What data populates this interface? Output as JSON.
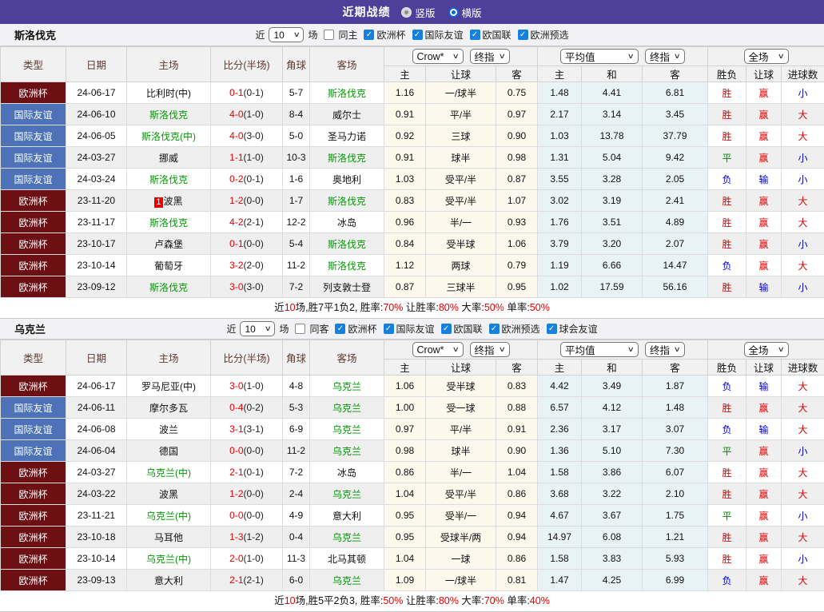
{
  "header": {
    "title": "近期战绩",
    "radios": [
      {
        "label": "竖版",
        "selected": false
      },
      {
        "label": "横版",
        "selected": true
      }
    ]
  },
  "colors": {
    "topbar_purple": "#4e3f9a",
    "type_euro_maroon": "#6d1014",
    "type_friendly_blue": "#4e72b8",
    "team_green": "#009900",
    "score_red": "#e60000",
    "lose_blue": "#0000dd",
    "draw_green": "#008800",
    "checkbox_blue": "#1580e0",
    "handicap_col_cream": "#fcf8ec",
    "euro_col_blue": "#e8f3f7"
  },
  "table_headers": {
    "main": [
      "类型",
      "日期",
      "主场",
      "比分(半场)",
      "角球",
      "客场"
    ],
    "sub": [
      "主",
      "让球",
      "客",
      "主",
      "和",
      "客",
      "胜负",
      "让球",
      "进球数"
    ]
  },
  "sections": [
    {
      "team": "斯洛伐克",
      "filter": {
        "prefix": "近",
        "count": "10",
        "suffix": "场",
        "same_label": "同主",
        "same_checked": false,
        "leagues": [
          "欧洲杯",
          "国际友谊",
          "欧国联",
          "欧洲预选"
        ]
      },
      "dropdowns": {
        "handicap_company": "Crow*",
        "handicap_time": "终指",
        "euro_company": "平均值",
        "euro_time": "终指",
        "scope": "全场"
      },
      "rows": [
        {
          "type": "欧洲杯",
          "date": "24-06-17",
          "home": "比利时(中)",
          "home_focus": false,
          "badge": "",
          "score": "0-1",
          "half": "(0-1)",
          "corner": "5-7",
          "away": "斯洛伐克",
          "away_focus": true,
          "h_home": "1.16",
          "h_line": "一/球半",
          "h_away": "0.75",
          "e_home": "1.48",
          "e_draw": "4.41",
          "e_away": "6.81",
          "result": "胜",
          "h_result": "赢",
          "goals": "小"
        },
        {
          "type": "国际友谊",
          "date": "24-06-10",
          "home": "斯洛伐克",
          "home_focus": true,
          "badge": "",
          "score": "4-0",
          "half": "(1-0)",
          "corner": "8-4",
          "away": "威尔士",
          "away_focus": false,
          "h_home": "0.91",
          "h_line": "平/半",
          "h_away": "0.97",
          "e_home": "2.17",
          "e_draw": "3.14",
          "e_away": "3.45",
          "result": "胜",
          "h_result": "赢",
          "goals": "大"
        },
        {
          "type": "国际友谊",
          "date": "24-06-05",
          "home": "斯洛伐克(中)",
          "home_focus": true,
          "badge": "",
          "score": "4-0",
          "half": "(3-0)",
          "corner": "5-0",
          "away": "圣马力诺",
          "away_focus": false,
          "h_home": "0.92",
          "h_line": "三球",
          "h_away": "0.90",
          "e_home": "1.03",
          "e_draw": "13.78",
          "e_away": "37.79",
          "result": "胜",
          "h_result": "赢",
          "goals": "大"
        },
        {
          "type": "国际友谊",
          "date": "24-03-27",
          "home": "挪威",
          "home_focus": false,
          "badge": "",
          "score": "1-1",
          "half": "(1-0)",
          "corner": "10-3",
          "away": "斯洛伐克",
          "away_focus": true,
          "h_home": "0.91",
          "h_line": "球半",
          "h_away": "0.98",
          "e_home": "1.31",
          "e_draw": "5.04",
          "e_away": "9.42",
          "result": "平",
          "h_result": "赢",
          "goals": "小"
        },
        {
          "type": "国际友谊",
          "date": "24-03-24",
          "home": "斯洛伐克",
          "home_focus": true,
          "badge": "",
          "score": "0-2",
          "half": "(0-1)",
          "corner": "1-6",
          "away": "奥地利",
          "away_focus": false,
          "h_home": "1.03",
          "h_line": "受平/半",
          "h_away": "0.87",
          "e_home": "3.55",
          "e_draw": "3.28",
          "e_away": "2.05",
          "result": "负",
          "h_result": "输",
          "goals": "小"
        },
        {
          "type": "欧洲杯",
          "date": "23-11-20",
          "home": "波黑",
          "home_focus": false,
          "badge": "1",
          "score": "1-2",
          "half": "(0-0)",
          "corner": "1-7",
          "away": "斯洛伐克",
          "away_focus": true,
          "h_home": "0.83",
          "h_line": "受平/半",
          "h_away": "1.07",
          "e_home": "3.02",
          "e_draw": "3.19",
          "e_away": "2.41",
          "result": "胜",
          "h_result": "赢",
          "goals": "大"
        },
        {
          "type": "欧洲杯",
          "date": "23-11-17",
          "home": "斯洛伐克",
          "home_focus": true,
          "badge": "",
          "score": "4-2",
          "half": "(2-1)",
          "corner": "12-2",
          "away": "冰岛",
          "away_focus": false,
          "h_home": "0.96",
          "h_line": "半/一",
          "h_away": "0.93",
          "e_home": "1.76",
          "e_draw": "3.51",
          "e_away": "4.89",
          "result": "胜",
          "h_result": "赢",
          "goals": "大"
        },
        {
          "type": "欧洲杯",
          "date": "23-10-17",
          "home": "卢森堡",
          "home_focus": false,
          "badge": "",
          "score": "0-1",
          "half": "(0-0)",
          "corner": "5-4",
          "away": "斯洛伐克",
          "away_focus": true,
          "h_home": "0.84",
          "h_line": "受半球",
          "h_away": "1.06",
          "e_home": "3.79",
          "e_draw": "3.20",
          "e_away": "2.07",
          "result": "胜",
          "h_result": "赢",
          "goals": "小"
        },
        {
          "type": "欧洲杯",
          "date": "23-10-14",
          "home": "葡萄牙",
          "home_focus": false,
          "badge": "",
          "score": "3-2",
          "half": "(2-0)",
          "corner": "11-2",
          "away": "斯洛伐克",
          "away_focus": true,
          "h_home": "1.12",
          "h_line": "两球",
          "h_away": "0.79",
          "e_home": "1.19",
          "e_draw": "6.66",
          "e_away": "14.47",
          "result": "负",
          "h_result": "赢",
          "goals": "大"
        },
        {
          "type": "欧洲杯",
          "date": "23-09-12",
          "home": "斯洛伐克",
          "home_focus": true,
          "badge": "",
          "score": "3-0",
          "half": "(3-0)",
          "corner": "7-2",
          "away": "列支敦士登",
          "away_focus": false,
          "h_home": "0.87",
          "h_line": "三球半",
          "h_away": "0.95",
          "e_home": "1.02",
          "e_draw": "17.59",
          "e_away": "56.16",
          "result": "胜",
          "h_result": "输",
          "goals": "小"
        }
      ],
      "summary": [
        {
          "t": "近"
        },
        {
          "t": "10",
          "r": 1
        },
        {
          "t": "场,胜7平1负2, 胜率:"
        },
        {
          "t": "70%",
          "r": 1
        },
        {
          "t": " 让胜率:"
        },
        {
          "t": "80%",
          "r": 1
        },
        {
          "t": " 大率:"
        },
        {
          "t": "50%",
          "r": 1
        },
        {
          "t": " 单率:"
        },
        {
          "t": "50%",
          "r": 1
        }
      ]
    },
    {
      "team": "乌克兰",
      "filter": {
        "prefix": "近",
        "count": "10",
        "suffix": "场",
        "same_label": "同客",
        "same_checked": false,
        "leagues": [
          "欧洲杯",
          "国际友谊",
          "欧国联",
          "欧洲预选",
          "球会友谊"
        ]
      },
      "dropdowns": {
        "handicap_company": "Crow*",
        "handicap_time": "终指",
        "euro_company": "平均值",
        "euro_time": "终指",
        "scope": "全场"
      },
      "rows": [
        {
          "type": "欧洲杯",
          "date": "24-06-17",
          "home": "罗马尼亚(中)",
          "home_focus": false,
          "badge": "",
          "score": "3-0",
          "half": "(1-0)",
          "corner": "4-8",
          "away": "乌克兰",
          "away_focus": true,
          "h_home": "1.06",
          "h_line": "受半球",
          "h_away": "0.83",
          "e_home": "4.42",
          "e_draw": "3.49",
          "e_away": "1.87",
          "result": "负",
          "h_result": "输",
          "goals": "大"
        },
        {
          "type": "国际友谊",
          "date": "24-06-11",
          "home": "摩尔多瓦",
          "home_focus": false,
          "badge": "",
          "score": "0-4",
          "half": "(0-2)",
          "corner": "5-3",
          "away": "乌克兰",
          "away_focus": true,
          "h_home": "1.00",
          "h_line": "受一球",
          "h_away": "0.88",
          "e_home": "6.57",
          "e_draw": "4.12",
          "e_away": "1.48",
          "result": "胜",
          "h_result": "赢",
          "goals": "大"
        },
        {
          "type": "国际友谊",
          "date": "24-06-08",
          "home": "波兰",
          "home_focus": false,
          "badge": "",
          "score": "3-1",
          "half": "(3-1)",
          "corner": "6-9",
          "away": "乌克兰",
          "away_focus": true,
          "h_home": "0.97",
          "h_line": "平/半",
          "h_away": "0.91",
          "e_home": "2.36",
          "e_draw": "3.17",
          "e_away": "3.07",
          "result": "负",
          "h_result": "输",
          "goals": "大"
        },
        {
          "type": "国际友谊",
          "date": "24-06-04",
          "home": "德国",
          "home_focus": false,
          "badge": "",
          "score": "0-0",
          "half": "(0-0)",
          "corner": "11-2",
          "away": "乌克兰",
          "away_focus": true,
          "h_home": "0.98",
          "h_line": "球半",
          "h_away": "0.90",
          "e_home": "1.36",
          "e_draw": "5.10",
          "e_away": "7.30",
          "result": "平",
          "h_result": "赢",
          "goals": "小"
        },
        {
          "type": "欧洲杯",
          "date": "24-03-27",
          "home": "乌克兰(中)",
          "home_focus": true,
          "badge": "",
          "score": "2-1",
          "half": "(0-1)",
          "corner": "7-2",
          "away": "冰岛",
          "away_focus": false,
          "h_home": "0.86",
          "h_line": "半/一",
          "h_away": "1.04",
          "e_home": "1.58",
          "e_draw": "3.86",
          "e_away": "6.07",
          "result": "胜",
          "h_result": "赢",
          "goals": "大"
        },
        {
          "type": "欧洲杯",
          "date": "24-03-22",
          "home": "波黑",
          "home_focus": false,
          "badge": "",
          "score": "1-2",
          "half": "(0-0)",
          "corner": "2-4",
          "away": "乌克兰",
          "away_focus": true,
          "h_home": "1.04",
          "h_line": "受平/半",
          "h_away": "0.86",
          "e_home": "3.68",
          "e_draw": "3.22",
          "e_away": "2.10",
          "result": "胜",
          "h_result": "赢",
          "goals": "大"
        },
        {
          "type": "欧洲杯",
          "date": "23-11-21",
          "home": "乌克兰(中)",
          "home_focus": true,
          "badge": "",
          "score": "0-0",
          "half": "(0-0)",
          "corner": "4-9",
          "away": "意大利",
          "away_focus": false,
          "h_home": "0.95",
          "h_line": "受半/一",
          "h_away": "0.94",
          "e_home": "4.67",
          "e_draw": "3.67",
          "e_away": "1.75",
          "result": "平",
          "h_result": "赢",
          "goals": "小"
        },
        {
          "type": "欧洲杯",
          "date": "23-10-18",
          "home": "马耳他",
          "home_focus": false,
          "badge": "",
          "score": "1-3",
          "half": "(1-2)",
          "corner": "0-4",
          "away": "乌克兰",
          "away_focus": true,
          "h_home": "0.95",
          "h_line": "受球半/两",
          "h_away": "0.94",
          "e_home": "14.97",
          "e_draw": "6.08",
          "e_away": "1.21",
          "result": "胜",
          "h_result": "赢",
          "goals": "大"
        },
        {
          "type": "欧洲杯",
          "date": "23-10-14",
          "home": "乌克兰(中)",
          "home_focus": true,
          "badge": "",
          "score": "2-0",
          "half": "(1-0)",
          "corner": "11-3",
          "away": "北马其顿",
          "away_focus": false,
          "h_home": "1.04",
          "h_line": "一球",
          "h_away": "0.86",
          "e_home": "1.58",
          "e_draw": "3.83",
          "e_away": "5.93",
          "result": "胜",
          "h_result": "赢",
          "goals": "小"
        },
        {
          "type": "欧洲杯",
          "date": "23-09-13",
          "home": "意大利",
          "home_focus": false,
          "badge": "",
          "score": "2-1",
          "half": "(2-1)",
          "corner": "6-0",
          "away": "乌克兰",
          "away_focus": true,
          "h_home": "1.09",
          "h_line": "一/球半",
          "h_away": "0.81",
          "e_home": "1.47",
          "e_draw": "4.25",
          "e_away": "6.99",
          "result": "负",
          "h_result": "赢",
          "goals": "大"
        }
      ],
      "summary": [
        {
          "t": "近"
        },
        {
          "t": "10",
          "r": 1
        },
        {
          "t": "场,胜5平2负3, 胜率:"
        },
        {
          "t": "50%",
          "r": 1
        },
        {
          "t": " 让胜率:"
        },
        {
          "t": "80%",
          "r": 1
        },
        {
          "t": " 大率:"
        },
        {
          "t": "70%",
          "r": 1
        },
        {
          "t": " 单率:"
        },
        {
          "t": "40%",
          "r": 1
        }
      ]
    }
  ]
}
